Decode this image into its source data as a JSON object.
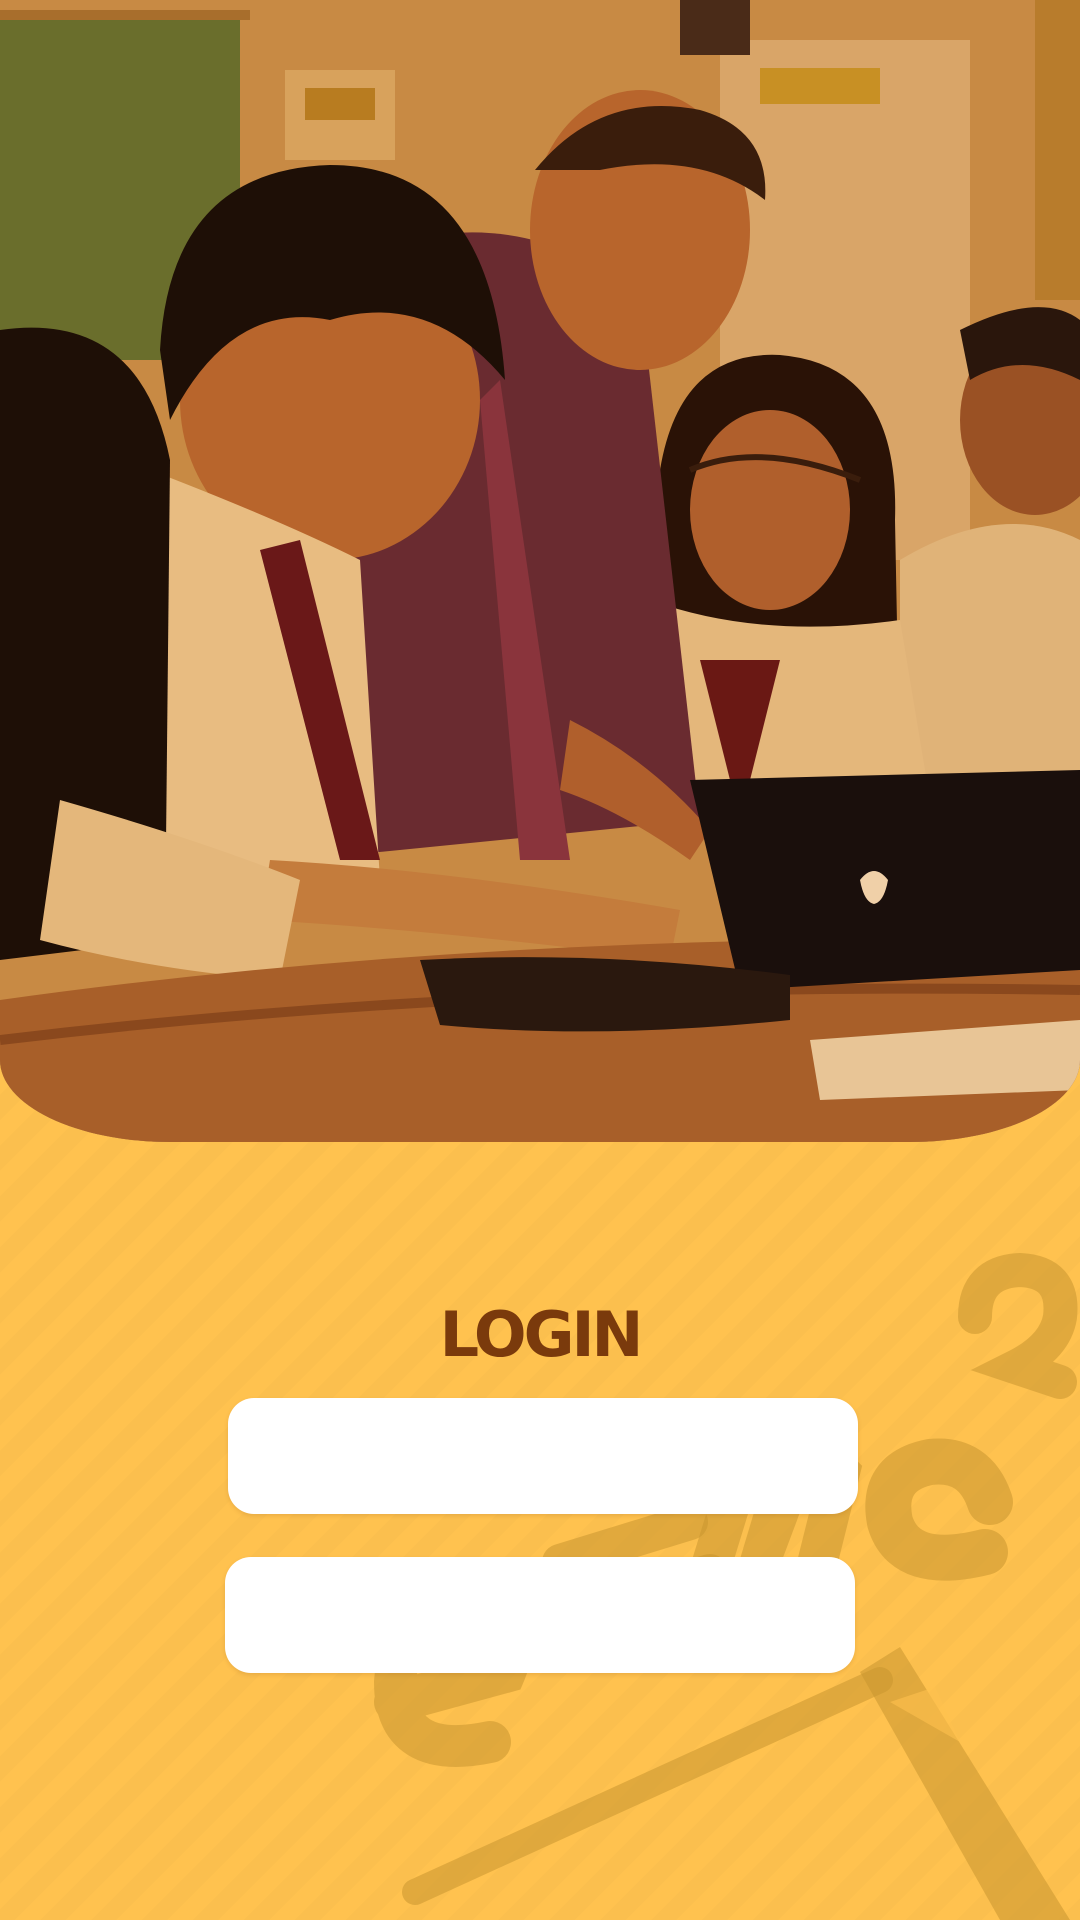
{
  "login": {
    "title": "LOGIN",
    "username_field": {
      "value": "",
      "placeholder": ""
    },
    "password_field": {
      "value": "",
      "placeholder": ""
    }
  },
  "colors": {
    "background": "#ffc24f",
    "title": "#7a3a0c",
    "field": "#ffffff"
  }
}
